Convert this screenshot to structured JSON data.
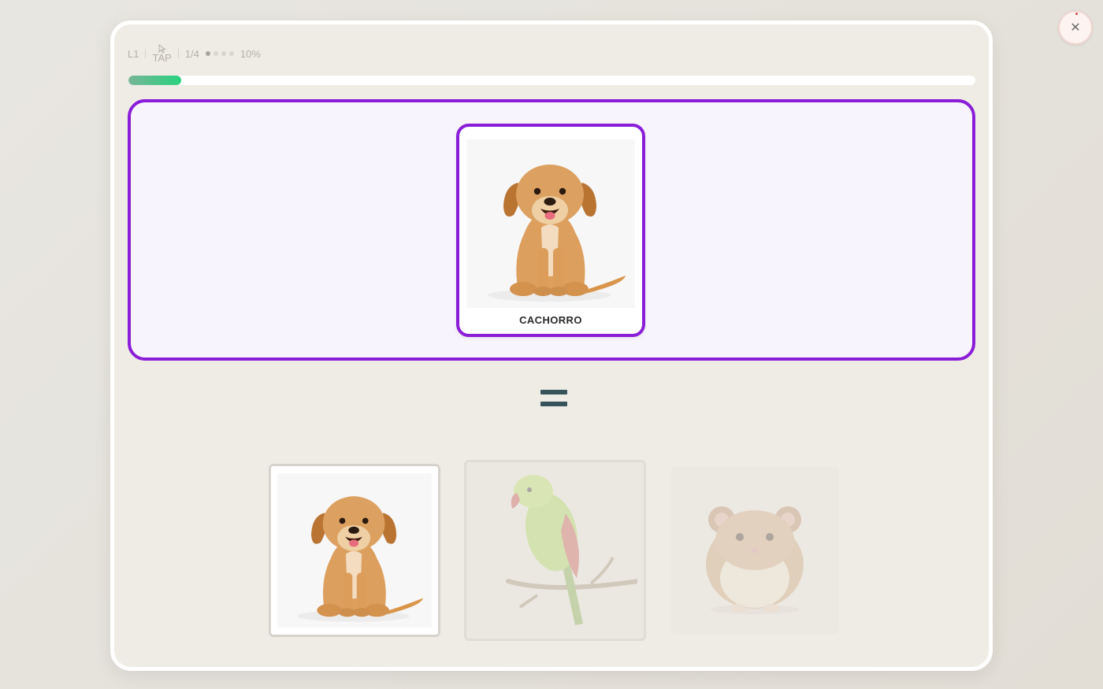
{
  "meta": {
    "level": "L1",
    "mode": "TAP",
    "counter": "1/4",
    "percent": "10%",
    "dots": 4,
    "active_dot": 1
  },
  "progress": {
    "value": 0.1,
    "color": "#28d27e"
  },
  "prompt": {
    "word": "CACHORRO",
    "image": "puppy",
    "highlight_color": "#8a1ed8"
  },
  "choices": [
    {
      "image": "puppy",
      "state": "selected"
    },
    {
      "image": "parrot",
      "state": "faded"
    },
    {
      "image": "hamster",
      "state": "faded"
    }
  ],
  "close": {
    "icon": "close-icon"
  }
}
